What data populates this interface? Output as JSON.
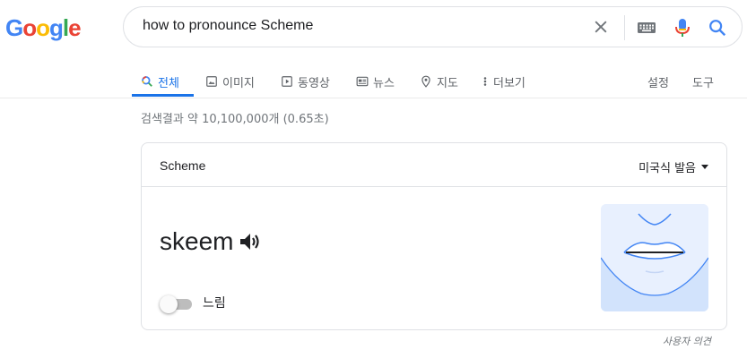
{
  "logo": {
    "text": "Google"
  },
  "search": {
    "query": "how to pronounce Scheme"
  },
  "tabs": [
    {
      "label": "전체",
      "icon": "search-icon"
    },
    {
      "label": "이미지",
      "icon": "image-icon"
    },
    {
      "label": "동영상",
      "icon": "video-icon"
    },
    {
      "label": "뉴스",
      "icon": "news-icon"
    },
    {
      "label": "지도",
      "icon": "map-pin-icon"
    },
    {
      "label": "더보기",
      "icon": "more-vert-icon"
    }
  ],
  "tools": {
    "settings": "설정",
    "tools": "도구"
  },
  "result_stats": "검색결과 약 10,100,000개 (0.65초)",
  "card": {
    "title": "Scheme",
    "dialect": "미국식 발음",
    "phonetic": "skeem",
    "slow_label": "느림"
  },
  "feedback": "사용자 의견",
  "colors": {
    "accent": "#1a73e8",
    "mouth_bg": "#e8f0fe",
    "line": "#4285f4"
  }
}
